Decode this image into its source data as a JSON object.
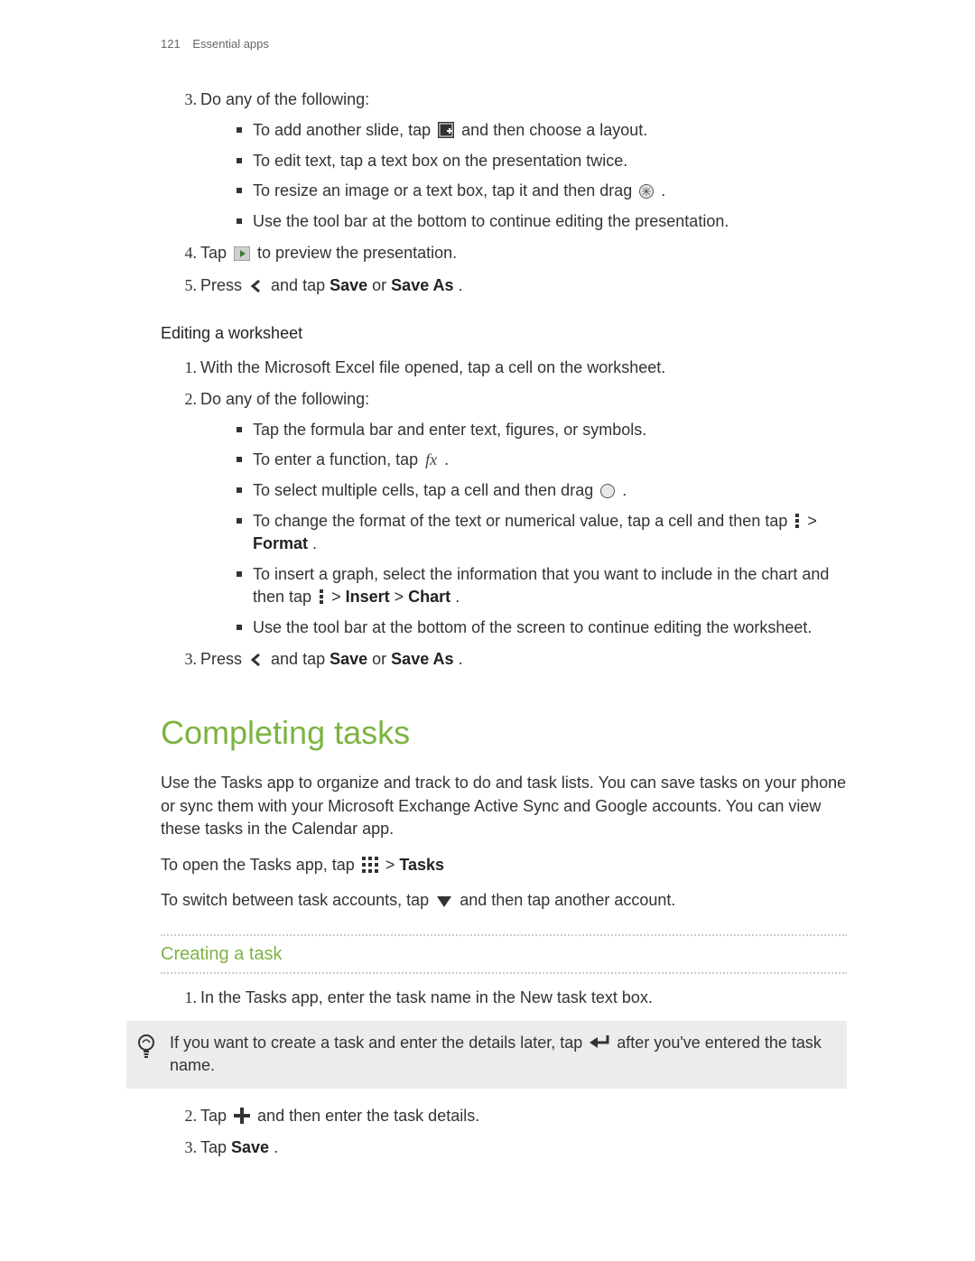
{
  "header": {
    "page_number": "121",
    "section": "Essential apps"
  },
  "presentation_steps": {
    "s3": {
      "num": "3",
      "intro": "Do any of the following:",
      "items": {
        "a_pre": "To add another slide, tap ",
        "a_post": " and then choose a layout.",
        "b": "To edit text, tap a text box on the presentation twice.",
        "c_pre": "To resize an image or a text box, tap it and then drag ",
        "c_post": " .",
        "d": "Use the tool bar at the bottom to continue editing the presentation."
      }
    },
    "s4": {
      "num": "4",
      "pre": "Tap ",
      "post": " to preview the presentation."
    },
    "s5": {
      "num": "5",
      "pre": "Press ",
      "mid1": " and tap ",
      "save": "Save",
      "or": " or ",
      "saveas": "Save As",
      "end": "."
    }
  },
  "worksheet": {
    "heading": "Editing a worksheet",
    "s1": {
      "num": "1",
      "text": "With the Microsoft Excel file opened, tap a cell on the worksheet."
    },
    "s2": {
      "num": "2",
      "intro": "Do any of the following:",
      "items": {
        "a": "Tap the formula bar and enter text, figures, or symbols.",
        "b_pre": "To enter a function, tap  ",
        "b_post": " .",
        "c_pre": "To select multiple cells, tap a cell and then drag ",
        "c_post": " .",
        "d_pre": "To change the format of the text or numerical value, tap a cell and then tap ",
        "d_mid": " > ",
        "d_format": "Format",
        "d_end": ".",
        "e_pre": "To insert a graph, select the information that you want to include in the chart and then tap ",
        "e_gt1": " > ",
        "e_insert": "Insert",
        "e_gt2": " > ",
        "e_chart": "Chart",
        "e_end": ".",
        "f": "Use the tool bar at the bottom of the screen to continue editing the worksheet."
      }
    },
    "s3": {
      "num": "3",
      "pre": "Press ",
      "mid1": " and tap ",
      "save": "Save",
      "or": " or ",
      "saveas": "Save As",
      "end": "."
    }
  },
  "tasks": {
    "heading": "Completing tasks",
    "para": "Use the Tasks app to organize and track to do and task lists. You can save tasks on your phone or sync them with your Microsoft Exchange Active Sync and Google accounts. You can view these tasks in the Calendar app.",
    "open_pre": "To open the Tasks app, tap ",
    "open_gt": " > ",
    "open_tasks": "Tasks",
    "switch_pre": "To switch between task accounts, tap ",
    "switch_post": " and then tap another account."
  },
  "create": {
    "heading": "Creating a task",
    "s1": {
      "num": "1",
      "text": "In the Tasks app, enter the task name in the New task text box."
    },
    "tip_pre": "If you want to create a task and enter the details later, tap ",
    "tip_post": " after you've entered the task name.",
    "s2": {
      "num": "2",
      "pre": "Tap ",
      "post": " and then enter the task details."
    },
    "s3": {
      "num": "3",
      "pre": "Tap ",
      "save": "Save",
      "end": "."
    }
  }
}
